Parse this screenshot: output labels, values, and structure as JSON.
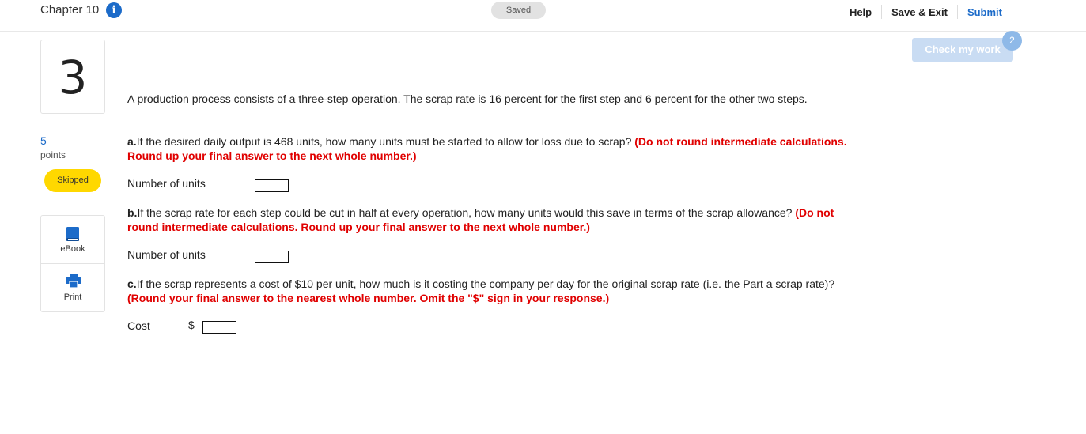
{
  "header": {
    "chapter_title": "Chapter 10",
    "info_icon": "info-icon",
    "saved_label": "Saved",
    "help_label": "Help",
    "save_exit_label": "Save & Exit",
    "submit_label": "Submit"
  },
  "check_my_work": {
    "label": "Check my work",
    "badge": "2"
  },
  "question": {
    "number": "3",
    "points_value": "5",
    "points_label": "points",
    "status": "Skipped"
  },
  "tools": {
    "ebook_label": "eBook",
    "ebook_icon": "book-icon",
    "print_label": "Print",
    "print_icon": "printer-icon"
  },
  "problem": {
    "intro": "A production process consists of a three-step operation. The scrap rate is 16 percent for the first step and 6 percent for the other two steps.",
    "part_a": {
      "letter": "a.",
      "text": "If the desired daily output is 468 units, how many units must be started to allow for loss due to scrap? ",
      "instruction": "(Do not round intermediate calculations. Round up your final answer to the next whole number.)",
      "field_label": "Number of units",
      "value": ""
    },
    "part_b": {
      "letter": "b.",
      "text": "If the scrap rate for each step could be cut in half at every operation, how many units would this save in terms of the scrap allowance? ",
      "instruction": "(Do not round intermediate calculations. Round up your final answer to the next whole number.)",
      "field_label": "Number of units",
      "value": ""
    },
    "part_c": {
      "letter": "c.",
      "text": "If the scrap represents a cost of $10 per unit, how much is it costing the company per day for the original scrap rate (i.e. the Part a scrap rate)? ",
      "instruction": "(Round your final answer to the nearest whole number. Omit the \"$\" sign in your response.)",
      "field_label": "Cost",
      "currency": "$",
      "value": ""
    }
  }
}
